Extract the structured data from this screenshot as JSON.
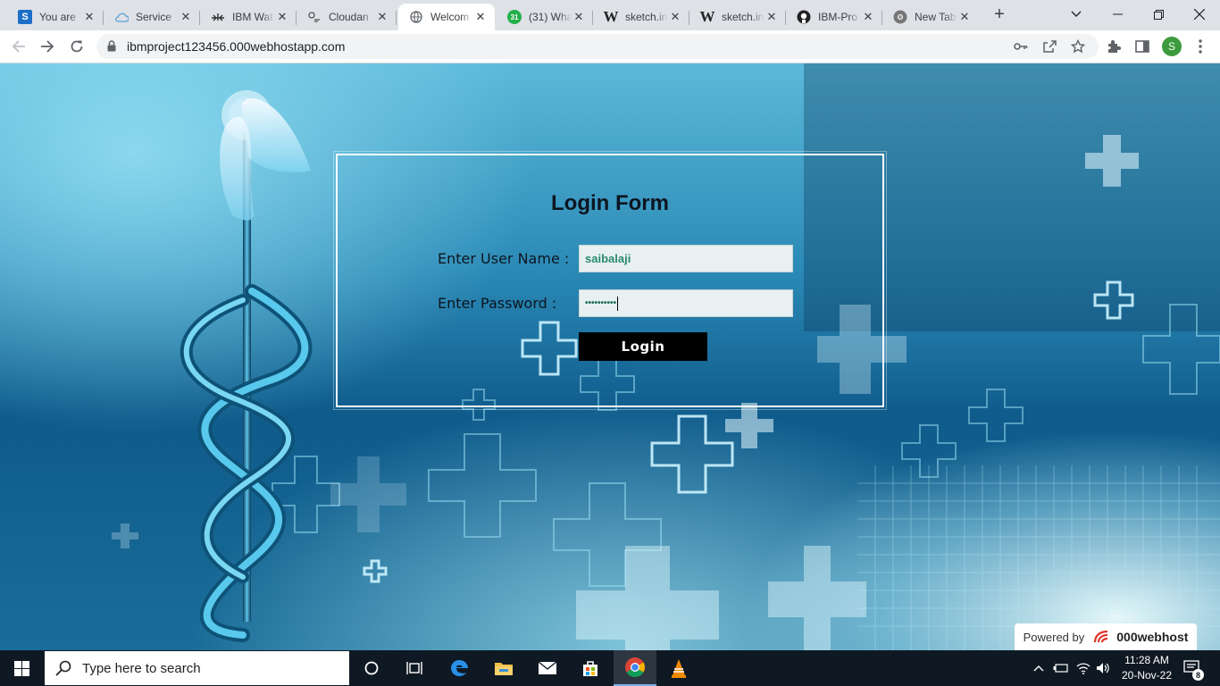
{
  "browser": {
    "tabs": [
      {
        "title": "You are",
        "favicon": "S"
      },
      {
        "title": "Service",
        "favicon": "cloud"
      },
      {
        "title": "IBM Wat",
        "favicon": "watson"
      },
      {
        "title": "Cloudan",
        "favicon": "cloudant"
      },
      {
        "title": "Welcom",
        "favicon": "globe"
      },
      {
        "title": "(31) Wha",
        "favicon": "31"
      },
      {
        "title": "sketch.in",
        "favicon": "W"
      },
      {
        "title": "sketch.in",
        "favicon": "W"
      },
      {
        "title": "IBM-Pro",
        "favicon": "github"
      },
      {
        "title": "New Tab",
        "favicon": "chrome"
      }
    ],
    "active_tab_index": 4,
    "url": "ibmproject123456.000webhostapp.com",
    "profile_initial": "S"
  },
  "login": {
    "title": "Login Form",
    "username_label": "Enter User Name :",
    "password_label": "Enter Password :",
    "username_value": "saibalaji",
    "password_value": "••••••••••",
    "button_label": "Login"
  },
  "footer": {
    "powered_by": "Powered by",
    "brand": "000webhost"
  },
  "taskbar": {
    "search_placeholder": "Type here to search",
    "time": "11:28 AM",
    "date": "20-Nov-22",
    "notification_count": "8"
  }
}
